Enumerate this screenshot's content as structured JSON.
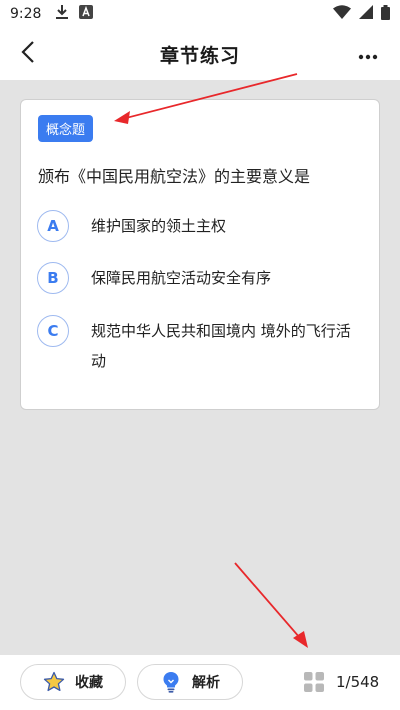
{
  "status_bar": {
    "time": "9:28"
  },
  "header": {
    "title": "章节练习"
  },
  "question": {
    "tag": "概念题",
    "text": "颁布《中国民用航空法》的主要意义是",
    "options": [
      {
        "letter": "A",
        "text": "维护国家的领土主权"
      },
      {
        "letter": "B",
        "text": "保障民用航空活动安全有序"
      },
      {
        "letter": "C",
        "text": "规范中华人民共和国境内 境外的飞行活动"
      }
    ]
  },
  "bottom_bar": {
    "favorite_label": "收藏",
    "analysis_label": "解析",
    "page_counter": "1/548"
  },
  "colors": {
    "accent": "#3b7cf0",
    "annotation_arrow": "#e8282b",
    "background": "#e3e3e3"
  }
}
